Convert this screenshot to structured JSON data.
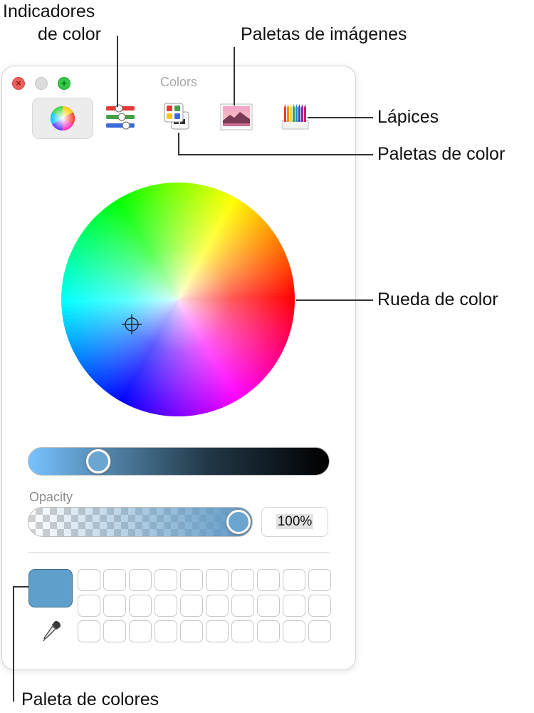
{
  "window": {
    "title": "Colors",
    "traffic_lights": {
      "close_glyph": "×",
      "zoom_glyph": "+"
    }
  },
  "toolbar": {
    "tools": [
      {
        "id": "color-wheel",
        "icon": "color-wheel-icon",
        "selected": true
      },
      {
        "id": "color-sliders",
        "icon": "sliders-icon",
        "selected": false
      },
      {
        "id": "color-palettes",
        "icon": "palettes-icon",
        "selected": false
      },
      {
        "id": "image-palettes",
        "icon": "image-icon",
        "selected": false
      },
      {
        "id": "pencils",
        "icon": "pencils-icon",
        "selected": false
      }
    ]
  },
  "brightness_slider": {
    "value_fraction": 0.23,
    "track_colors": [
      "#78c2ff",
      "#000000"
    ]
  },
  "opacity": {
    "label": "Opacity",
    "value": "100%",
    "value_fraction": 1.0
  },
  "current_color": "#5f9fcb",
  "swatch_grid": {
    "rows": 3,
    "columns": 10
  },
  "callouts": {
    "indicadores_line1": "Indicadores",
    "indicadores_line2": "de color",
    "paletas_imagenes": "Paletas de imágenes",
    "lapices": "Lápices",
    "paletas_color": "Paletas de color",
    "rueda_color": "Rueda de color",
    "paleta_colores": "Paleta de colores"
  }
}
